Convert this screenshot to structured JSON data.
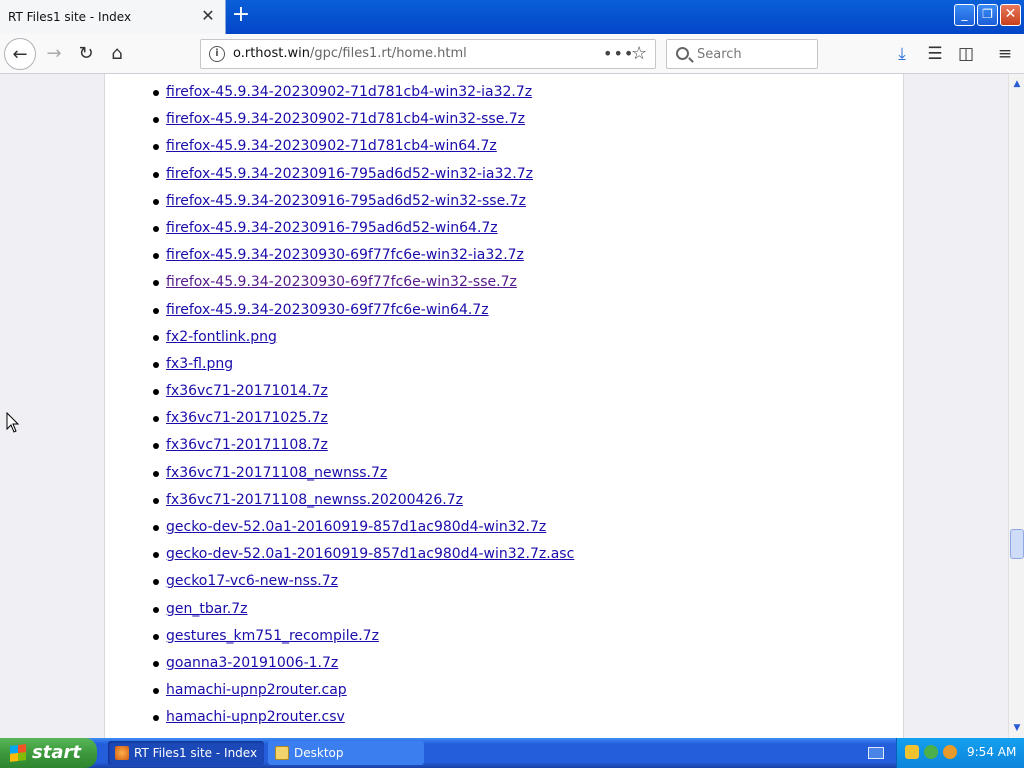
{
  "browser": {
    "tab_title": "RT Files1 site - Index",
    "tab_close": "✕",
    "new_tab": "+",
    "url_host": "o.rthost.win",
    "url_path": "/gpc/files1.rt/home.html",
    "search_placeholder": "Search",
    "window_buttons": [
      "_",
      "❐",
      "✕"
    ]
  },
  "files": [
    {
      "name": "firefox-45.9.34-20230902-71d781cb4-win32-ia32.7z",
      "visited": false
    },
    {
      "name": "firefox-45.9.34-20230902-71d781cb4-win32-sse.7z",
      "visited": false
    },
    {
      "name": "firefox-45.9.34-20230902-71d781cb4-win64.7z",
      "visited": false
    },
    {
      "name": "firefox-45.9.34-20230916-795ad6d52-win32-ia32.7z",
      "visited": false
    },
    {
      "name": "firefox-45.9.34-20230916-795ad6d52-win32-sse.7z",
      "visited": false
    },
    {
      "name": "firefox-45.9.34-20230916-795ad6d52-win64.7z",
      "visited": false
    },
    {
      "name": "firefox-45.9.34-20230930-69f77fc6e-win32-ia32.7z",
      "visited": false
    },
    {
      "name": "firefox-45.9.34-20230930-69f77fc6e-win32-sse.7z",
      "visited": true
    },
    {
      "name": "firefox-45.9.34-20230930-69f77fc6e-win64.7z",
      "visited": false
    },
    {
      "name": "fx2-fontlink.png",
      "visited": false
    },
    {
      "name": "fx3-fl.png",
      "visited": false
    },
    {
      "name": "fx36vc71-20171014.7z",
      "visited": false
    },
    {
      "name": "fx36vc71-20171025.7z",
      "visited": false
    },
    {
      "name": "fx36vc71-20171108.7z",
      "visited": false
    },
    {
      "name": "fx36vc71-20171108_newnss.7z",
      "visited": false
    },
    {
      "name": "fx36vc71-20171108_newnss.20200426.7z",
      "visited": false
    },
    {
      "name": "gecko-dev-52.0a1-20160919-857d1ac980d4-win32.7z",
      "visited": false
    },
    {
      "name": "gecko-dev-52.0a1-20160919-857d1ac980d4-win32.7z.asc",
      "visited": false
    },
    {
      "name": "gecko17-vc6-new-nss.7z",
      "visited": false
    },
    {
      "name": "gen_tbar.7z",
      "visited": false
    },
    {
      "name": "gestures_km751_recompile.7z",
      "visited": false
    },
    {
      "name": "goanna3-20191006-1.7z",
      "visited": false
    },
    {
      "name": "hamachi-upnp2router.cap",
      "visited": false
    },
    {
      "name": "hamachi-upnp2router.csv",
      "visited": false
    }
  ],
  "taskbar": {
    "start_label": "start",
    "items": [
      {
        "label": "RT Files1 site - Index ..."
      },
      {
        "label": "Desktop"
      }
    ],
    "clock": "9:54 AM"
  },
  "colors": {
    "link": "#1a0dab",
    "visited_link": "#551a8b",
    "taskbar": "#245edb",
    "start": "#3c9a3c"
  }
}
